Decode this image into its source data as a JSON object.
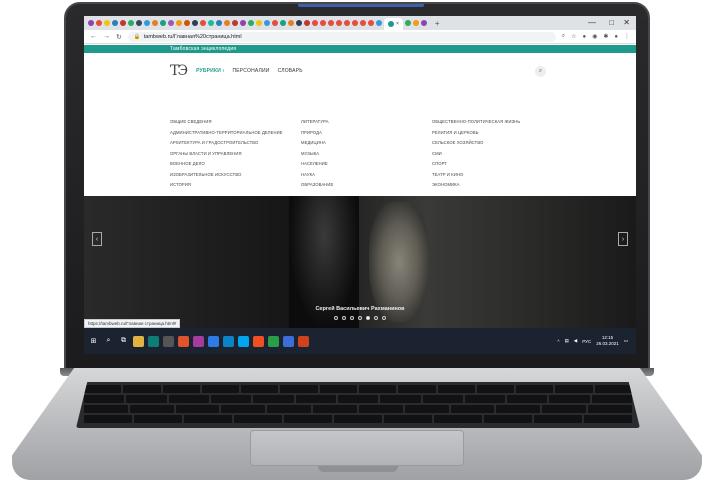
{
  "browser": {
    "active_tab_close": "×",
    "new_tab": "+",
    "url": "tambweb.ru/Главная%20страница.html",
    "status_url": "https://tambweb.ru/Главная страница.html#",
    "window_minimize": "—",
    "window_maximize": "□",
    "window_close": "✕"
  },
  "site": {
    "topbar_title": "Тамбовская энциклопедия",
    "logo_text": "ТЭ",
    "nav": {
      "rubrics": "РУБРИКИ ›",
      "persons": "ПЕРСОНАЛИИ",
      "dictionary": "СЛОВАРЬ"
    },
    "rubrics": {
      "col1": [
        "ОБЩИЕ СВЕДЕНИЯ",
        "АДМИНИСТРАТИВНО-ТЕРРИТОРИАЛЬНОЕ ДЕЛЕНИЕ",
        "АРХИТЕКТУРА И ГРАДОСТРОИТЕЛЬСТВО",
        "ОРГАНЫ ВЛАСТИ И УПРАВЛЕНИЯ",
        "ВОЕННОЕ ДЕЛО",
        "ИЗОБРАЗИТЕЛЬНОЕ ИСКУССТВО",
        "ИСТОРИЯ"
      ],
      "col2": [
        "ЛИТЕРАТУРА",
        "ПРИРОДА",
        "МЕДИЦИНА",
        "МУЗЫКА",
        "НАСЕЛЕНИЕ",
        "НАУКА",
        "ОБРАЗОВАНИЕ"
      ],
      "col3": [
        "ОБЩЕСТВЕННО-ПОЛИТИЧЕСКАЯ ЖИЗНЬ",
        "РЕЛИГИЯ И ЦЕРКОВЬ",
        "СЕЛЬСКОЕ ХОЗЯЙСТВО",
        "СМИ",
        "СПОРТ",
        "ТЕАТР И КИНО",
        "ЭКОНОМИКА"
      ]
    },
    "slider": {
      "caption": "Сергей Васильевич Рахманинов",
      "prev": "‹",
      "next": "›",
      "dot_count": 7,
      "active_dot": 4
    }
  },
  "taskbar": {
    "language": "РУС",
    "time": "12:15",
    "date": "26.03.2021"
  },
  "colors": {
    "accent": "#1f9b8d",
    "taskbar": "#1b2330"
  }
}
